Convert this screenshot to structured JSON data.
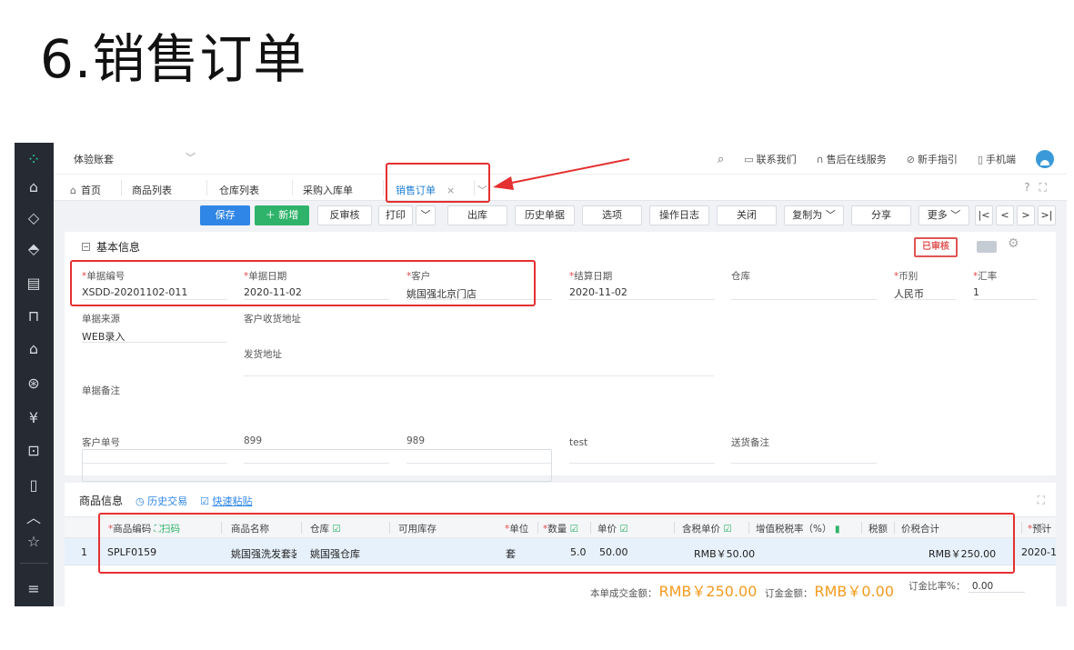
{
  "slide": {
    "title": "6.销售订单"
  },
  "nav": {
    "rail_icons": [
      "logo-icon",
      "home-icon",
      "tag-icon",
      "coupon-icon",
      "report-icon",
      "bag-icon",
      "house-icon",
      "finance-icon",
      "yen-icon",
      "monitor-icon",
      "ticket-icon",
      "collapse-icon",
      "star-icon",
      "menu-icon"
    ]
  },
  "topbar": {
    "account": "体验账套",
    "links": [
      {
        "icon": "search-icon",
        "label": ""
      },
      {
        "icon": "chat-icon",
        "label": "联系我们"
      },
      {
        "icon": "headset-icon",
        "label": "售后在线服务"
      },
      {
        "icon": "compass-icon",
        "label": "新手指引"
      },
      {
        "icon": "phone-icon",
        "label": "手机端"
      }
    ]
  },
  "tabs": {
    "home": "首页",
    "items": [
      "商品列表",
      "仓库列表",
      "采购入库单"
    ],
    "active": "销售订单"
  },
  "toolbar": {
    "save": "保存",
    "add": "＋ 新增",
    "unaudit": "反审核",
    "print": "打印",
    "outbound": "出库",
    "history": "历史单据",
    "options": "选项",
    "log": "操作日志",
    "close": "关闭",
    "copy": "复制为",
    "share": "分享",
    "more": "更多"
  },
  "basic": {
    "title": "基本信息",
    "stamp": "已审核",
    "fields": {
      "doc_no": {
        "label": "单据编号",
        "value": "XSDD-20201102-011"
      },
      "doc_date": {
        "label": "单据日期",
        "value": "2020-11-02"
      },
      "customer": {
        "label": "客户",
        "value": "姚国强北京门店"
      },
      "settle_date": {
        "label": "结算日期",
        "value": "2020-11-02"
      },
      "warehouse": {
        "label": "仓库",
        "value": ""
      },
      "currency": {
        "label": "币别",
        "value": "人民币"
      },
      "rate": {
        "label": "汇率",
        "value": "1"
      },
      "source": {
        "label": "单据来源",
        "value": "WEB录入"
      },
      "recv_addr": {
        "label": "客户收货地址",
        "value": ""
      },
      "ship_addr": {
        "label": "发货地址",
        "value": ""
      },
      "remark": {
        "label": "单据备注",
        "value": ""
      },
      "cust_no": {
        "label": "客户单号",
        "value": ""
      },
      "c1": {
        "label": "899",
        "value": ""
      },
      "c2": {
        "label": "989",
        "value": ""
      },
      "c3": {
        "label": "test",
        "value": ""
      },
      "delivery_note": {
        "label": "送货备注",
        "value": ""
      }
    }
  },
  "products": {
    "title": "商品信息",
    "history_link": "历史交易",
    "paste_link": "快速粘贴",
    "headers": {
      "code": "商品编码",
      "scan": "扫码",
      "name": "商品名称",
      "warehouse": "仓库",
      "stock": "可用库存",
      "unit": "单位",
      "qty": "数量",
      "price": "单价",
      "tax_price": "含税单价",
      "tax_rate": "增值税税率（%）",
      "tax": "税额",
      "total": "价税合计",
      "predict": "预计"
    },
    "rows": [
      {
        "no": "1",
        "code": "SPLF0159",
        "name": "姚国强洗发套装",
        "warehouse": "姚国强仓库",
        "unit": "套",
        "qty": "5.0",
        "price": "50.00",
        "tax_price": "RMB￥50.00",
        "total": "RMB￥250.00",
        "predict": "2020-1"
      }
    ],
    "totals": {
      "deal_label": "本单成交金额：",
      "deal_value": "RMB￥250.00",
      "deposit_label": "订金金额：",
      "deposit_value": "RMB￥0.00",
      "ratio_label": "订金比率%：",
      "ratio_value": "0.00"
    }
  },
  "colors": {
    "primary": "#2f86e6",
    "green": "#2fb36a",
    "rail": "#262a33",
    "highlight": "#e53030",
    "amount": "#f39a1e"
  }
}
